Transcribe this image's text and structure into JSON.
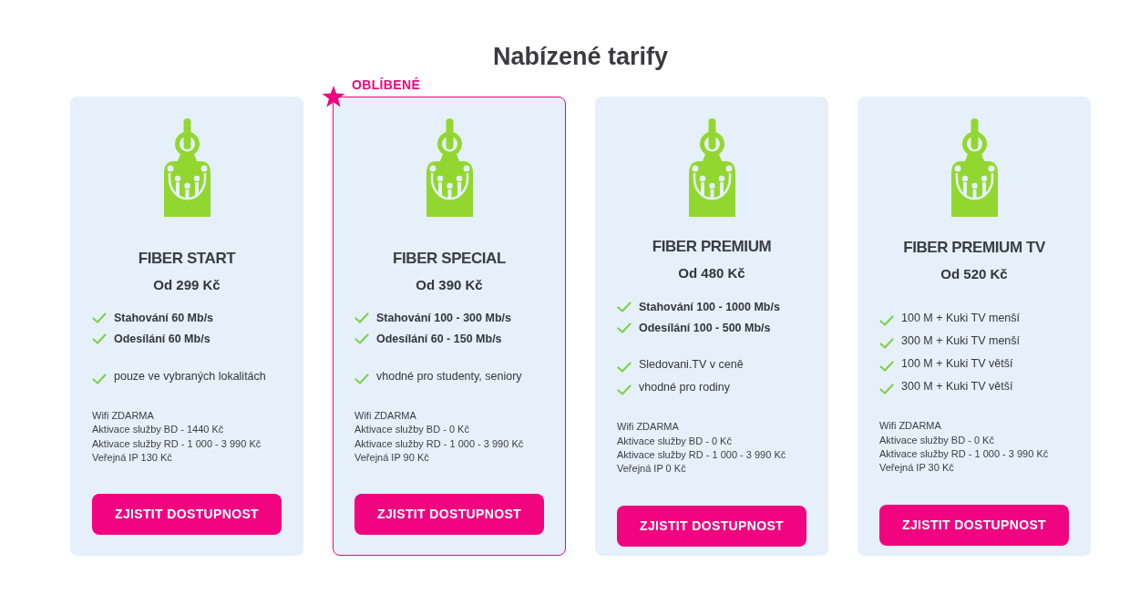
{
  "heading": "Nabízené tarify",
  "plans": [
    {
      "title": "FIBER START",
      "price": "Od 299 Kč",
      "featured": false,
      "speeds": [
        "Stahování 60 Mb/s",
        "Odesílání 60 Mb/s"
      ],
      "extras": [
        "pouze ve vybraných lokalitách"
      ],
      "details": [
        "Wifi ZDARMA",
        "Aktivace služby BD - 1440 Kč",
        "Aktivace služby RD - 1 000 - 3 990 Kč",
        "Veřejná IP 130 Kč"
      ],
      "button": "ZJISTIT DOSTUPNOST"
    },
    {
      "title": "FIBER SPECIAL",
      "price": "Od 390 Kč",
      "featured": true,
      "badge": "OBLÍBENÉ",
      "speeds": [
        "Stahování 100 - 300 Mb/s",
        "Odesílání 60 - 150 Mb/s"
      ],
      "extras": [
        "vhodné pro studenty, seniory"
      ],
      "details": [
        "Wifi ZDARMA",
        "Aktivace služby BD - 0 Kč",
        "Aktivace služby RD - 1 000 - 3 990 Kč",
        "Veřejná IP 90 Kč"
      ],
      "button": "ZJISTIT DOSTUPNOST"
    },
    {
      "title": "FIBER PREMIUM",
      "price": "Od 480 Kč",
      "featured": false,
      "speeds": [
        "Stahování 100 - 1000 Mb/s",
        "Odesílání 100 - 500 Mb/s"
      ],
      "extras": [
        "Sledovani.TV v ceně",
        "vhodné pro rodiny"
      ],
      "details": [
        "Wifi ZDARMA",
        "Aktivace služby BD - 0 Kč",
        "Aktivace služby RD - 1 000 - 3 990 Kč",
        "Veřejná IP 0 Kč"
      ],
      "button": "ZJISTIT DOSTUPNOST"
    },
    {
      "title": "FIBER PREMIUM TV",
      "price": "Od 520 Kč",
      "featured": false,
      "extras": [
        "100 M + Kuki TV menší",
        "300 M + Kuki TV menší",
        "100 M + Kuki TV větší",
        "300 M + Kuki TV větší"
      ],
      "details": [
        "Wifi ZDARMA",
        "Aktivace služby BD - 0 Kč",
        "Aktivace služby RD - 1 000 - 3 990 Kč",
        "Veřejná IP 30 Kč"
      ],
      "button": "ZJISTIT DOSTUPNOST"
    }
  ]
}
